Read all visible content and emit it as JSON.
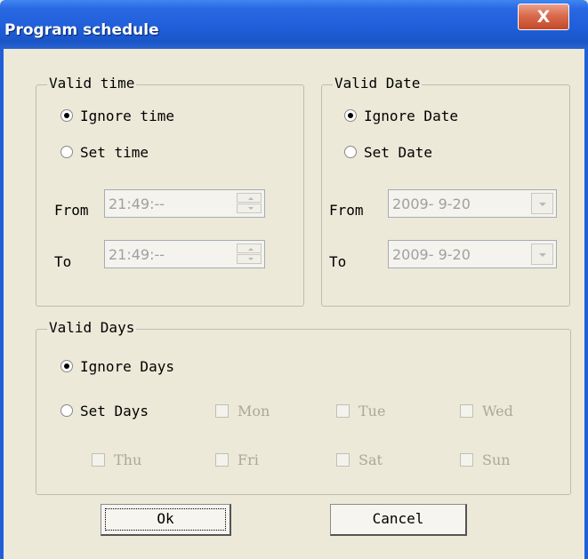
{
  "window": {
    "title": "Program schedule",
    "close_label": "X"
  },
  "valid_time": {
    "legend": "Valid time",
    "ignore_label": "Ignore time",
    "set_label": "Set time",
    "selected": "ignore",
    "from_label": "From",
    "to_label": "To",
    "from_value": "21:49:--",
    "to_value": "21:49:--"
  },
  "valid_date": {
    "legend": "Valid Date",
    "ignore_label": "Ignore Date",
    "set_label": "Set Date",
    "selected": "ignore",
    "from_label": "From",
    "to_label": "To",
    "from_value": "2009- 9-20",
    "to_value": "2009- 9-20"
  },
  "valid_days": {
    "legend": "Valid Days",
    "ignore_label": "Ignore Days",
    "set_label": "Set Days",
    "selected": "ignore",
    "days": [
      "Mon",
      "Tue",
      "Wed",
      "Thu",
      "Fri",
      "Sat",
      "Sun"
    ]
  },
  "buttons": {
    "ok": "Ok",
    "cancel": "Cancel"
  },
  "icons": {
    "close": "close-icon",
    "spin": "spinner-arrows-icon",
    "dropdown": "chevron-down-icon"
  },
  "colors": {
    "titlebar": "#1f5fd9",
    "background": "#ece9d8",
    "disabled_text": "#a0a0a0"
  }
}
